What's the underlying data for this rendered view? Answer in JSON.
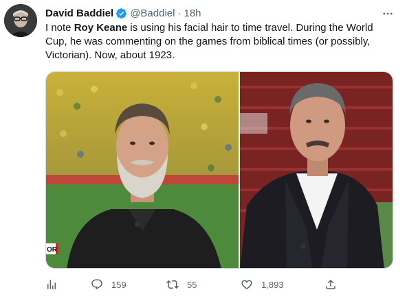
{
  "author": {
    "name": "David Baddiel",
    "handle": "@Baddiel",
    "separator": "·",
    "time": "18h"
  },
  "tweet": {
    "text_before": "I note ",
    "text_bold": "Roy Keane",
    "text_after": " is using his facial hair to time travel. During the World Cup, he was commenting on the games from biblical times (or possibly, Victorian). Now, about 1923."
  },
  "media": {
    "left_caption": "OR"
  },
  "actions": {
    "analytics_icon": "analytics-icon",
    "replies": "159",
    "retweets": "55",
    "likes": "1,893",
    "share_icon": "share-icon"
  },
  "colors": {
    "text": "#0f1419",
    "muted": "#536471",
    "verified": "#1d9bf0",
    "border": "#cfd9de"
  }
}
